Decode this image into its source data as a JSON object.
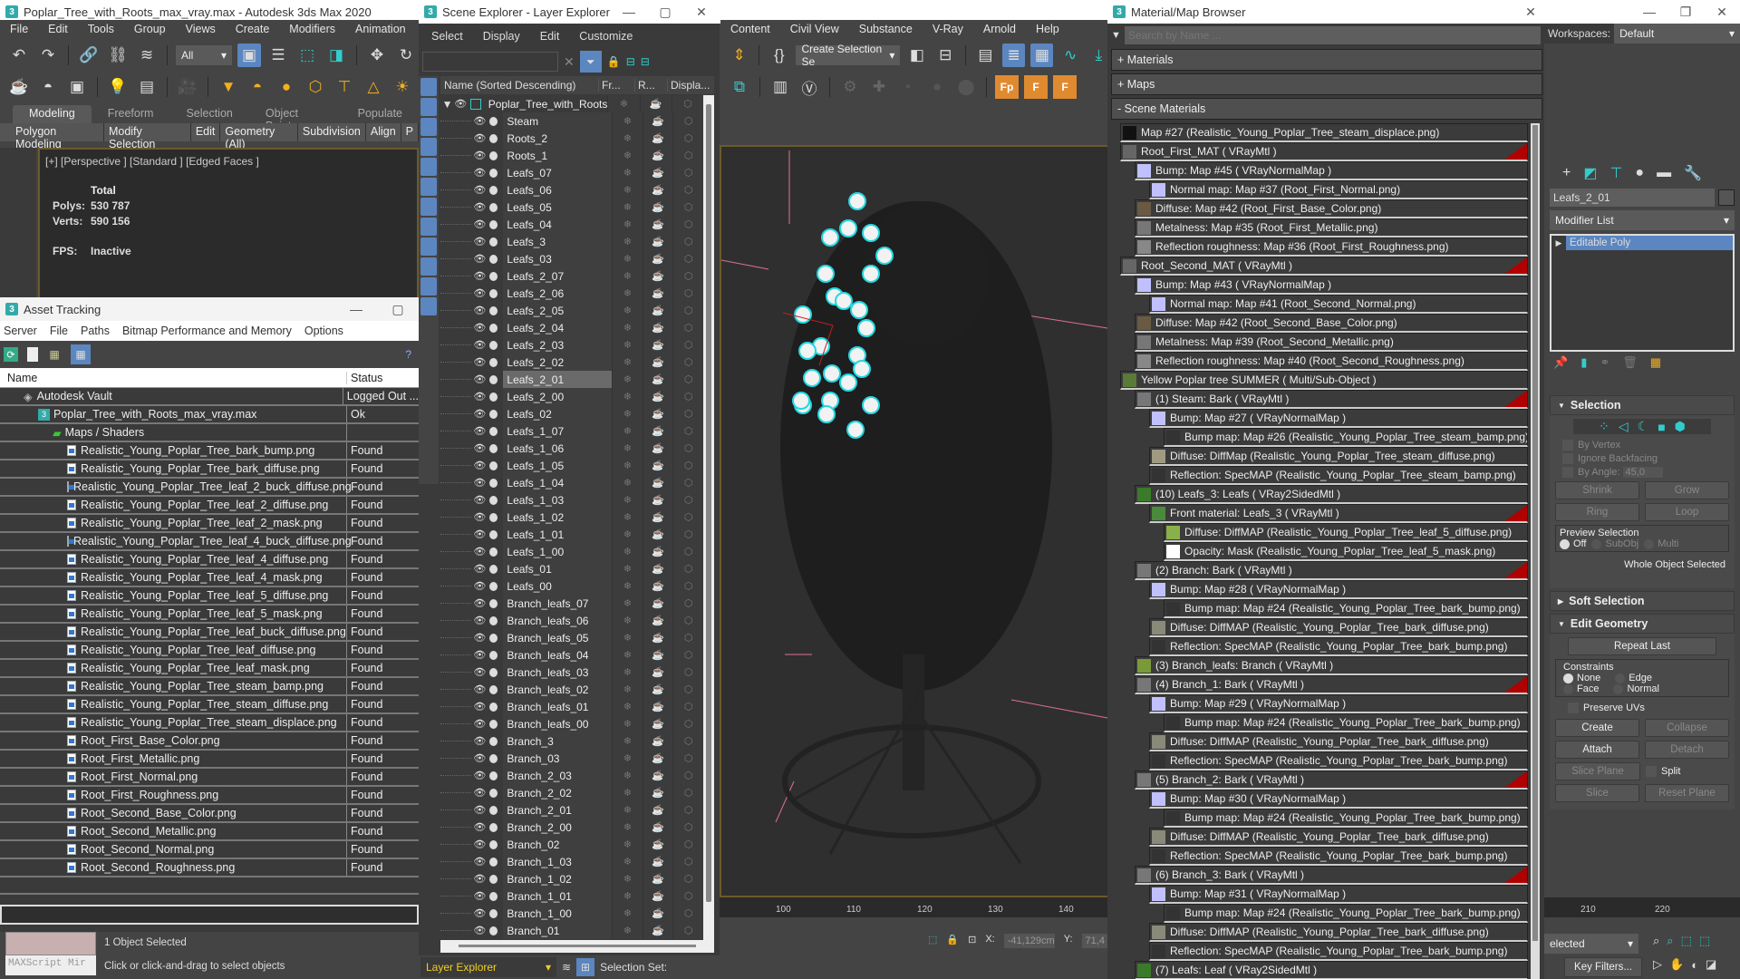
{
  "app": {
    "title": "Poplar_Tree_with_Roots_max_vray.max - Autodesk 3ds Max 2020",
    "logo": "3",
    "menu": [
      "File",
      "Edit",
      "Tools",
      "Group",
      "Views",
      "Create",
      "Modifiers",
      "Animation"
    ],
    "menu_right": [
      "Content",
      "Civil View",
      "Substance",
      "V-Ray",
      "Arnold",
      "Help"
    ],
    "selection_filter": "All",
    "create_selection_set": "Create Selection Se",
    "workspaces_label": "Workspaces:",
    "workspaces_value": "Default",
    "ribbon_tabs": [
      "Modeling",
      "Freeform",
      "Selection",
      "Object Paint",
      "Populate"
    ],
    "ribbon_items": [
      "Polygon Modeling",
      "Modify Selection",
      "Edit",
      "Geometry (All)",
      "Subdivision",
      "Align",
      "P"
    ]
  },
  "viewport": {
    "label": "[+] [Perspective ] [Standard ] [Edged Faces ]",
    "stats_header": "Total",
    "polys_label": "Polys:",
    "polys_value": "530 787",
    "verts_label": "Verts:",
    "verts_value": "590 156",
    "fps_label": "FPS:",
    "fps_value": "Inactive",
    "ruler_ticks": [
      "100",
      "110",
      "120",
      "130",
      "140"
    ],
    "ruler_ticks_right": [
      "210",
      "220"
    ],
    "x_label": "X:",
    "x_value": "-41,129cm",
    "y_label": "Y:",
    "y_value": "71,4"
  },
  "asset_tracking": {
    "title": "Asset Tracking",
    "menu": [
      "Server",
      "File",
      "Paths",
      "Bitmap Performance and Memory",
      "Options"
    ],
    "col_name": "Name",
    "col_status": "Status",
    "vault": {
      "name": "Autodesk Vault",
      "status": "Logged Out ..."
    },
    "file": {
      "name": "Poplar_Tree_with_Roots_max_vray.max",
      "status": "Ok"
    },
    "group": "Maps / Shaders",
    "items": [
      {
        "name": "Realistic_Young_Poplar_Tree_bark_bump.png",
        "status": "Found"
      },
      {
        "name": "Realistic_Young_Poplar_Tree_bark_diffuse.png",
        "status": "Found"
      },
      {
        "name": "Realistic_Young_Poplar_Tree_leaf_2_buck_diffuse.png",
        "status": "Found"
      },
      {
        "name": "Realistic_Young_Poplar_Tree_leaf_2_diffuse.png",
        "status": "Found"
      },
      {
        "name": "Realistic_Young_Poplar_Tree_leaf_2_mask.png",
        "status": "Found"
      },
      {
        "name": "Realistic_Young_Poplar_Tree_leaf_4_buck_diffuse.png",
        "status": "Found"
      },
      {
        "name": "Realistic_Young_Poplar_Tree_leaf_4_diffuse.png",
        "status": "Found"
      },
      {
        "name": "Realistic_Young_Poplar_Tree_leaf_4_mask.png",
        "status": "Found"
      },
      {
        "name": "Realistic_Young_Poplar_Tree_leaf_5_diffuse.png",
        "status": "Found"
      },
      {
        "name": "Realistic_Young_Poplar_Tree_leaf_5_mask.png",
        "status": "Found"
      },
      {
        "name": "Realistic_Young_Poplar_Tree_leaf_buck_diffuse.png",
        "status": "Found"
      },
      {
        "name": "Realistic_Young_Poplar_Tree_leaf_diffuse.png",
        "status": "Found"
      },
      {
        "name": "Realistic_Young_Poplar_Tree_leaf_mask.png",
        "status": "Found"
      },
      {
        "name": "Realistic_Young_Poplar_Tree_steam_bamp.png",
        "status": "Found"
      },
      {
        "name": "Realistic_Young_Poplar_Tree_steam_diffuse.png",
        "status": "Found"
      },
      {
        "name": "Realistic_Young_Poplar_Tree_steam_displace.png",
        "status": "Found"
      },
      {
        "name": "Root_First_Base_Color.png",
        "status": "Found"
      },
      {
        "name": "Root_First_Metallic.png",
        "status": "Found"
      },
      {
        "name": "Root_First_Normal.png",
        "status": "Found"
      },
      {
        "name": "Root_First_Roughness.png",
        "status": "Found"
      },
      {
        "name": "Root_Second_Base_Color.png",
        "status": "Found"
      },
      {
        "name": "Root_Second_Metallic.png",
        "status": "Found"
      },
      {
        "name": "Root_Second_Normal.png",
        "status": "Found"
      },
      {
        "name": "Root_Second_Roughness.png",
        "status": "Found"
      }
    ]
  },
  "scene_explorer": {
    "title": "Scene Explorer - Layer Explorer",
    "menu": [
      "Select",
      "Display",
      "Edit",
      "Customize"
    ],
    "col_name": "Name (Sorted Descending)",
    "col_freeze": "Fr...",
    "col_render": "R...",
    "col_display": "Displa...",
    "root": "Poplar_Tree_with_Roots",
    "selected": "Leafs_2_01",
    "items": [
      "Steam",
      "Roots_2",
      "Roots_1",
      "Leafs_07",
      "Leafs_06",
      "Leafs_05",
      "Leafs_04",
      "Leafs_3",
      "Leafs_03",
      "Leafs_2_07",
      "Leafs_2_06",
      "Leafs_2_05",
      "Leafs_2_04",
      "Leafs_2_03",
      "Leafs_2_02",
      "Leafs_2_01",
      "Leafs_2_00",
      "Leafs_02",
      "Leafs_1_07",
      "Leafs_1_06",
      "Leafs_1_05",
      "Leafs_1_04",
      "Leafs_1_03",
      "Leafs_1_02",
      "Leafs_1_01",
      "Leafs_1_00",
      "Leafs_01",
      "Leafs_00",
      "Branch_leafs_07",
      "Branch_leafs_06",
      "Branch_leafs_05",
      "Branch_leafs_04",
      "Branch_leafs_03",
      "Branch_leafs_02",
      "Branch_leafs_01",
      "Branch_leafs_00",
      "Branch_3",
      "Branch_03",
      "Branch_2_03",
      "Branch_2_02",
      "Branch_2_01",
      "Branch_2_00",
      "Branch_02",
      "Branch_1_03",
      "Branch_1_02",
      "Branch_1_01",
      "Branch_1_00",
      "Branch_01"
    ],
    "footer_mode": "Layer Explorer",
    "selection_set_label": "Selection Set:"
  },
  "material_browser": {
    "title": "Material/Map Browser",
    "search_placeholder": "Search by Name ...",
    "sections": [
      "+ Materials",
      "+ Maps",
      "- Scene Materials"
    ],
    "rows": [
      {
        "text": "Map #27 (Realistic_Young_Poplar_Tree_steam_displace.png)",
        "indent": 0,
        "swatch": "#111111",
        "red": false
      },
      {
        "text": "Root_First_MAT  ( VRayMtl )",
        "indent": 0,
        "swatch": "#666666",
        "red": true
      },
      {
        "text": "Bump: Map #45  ( VRayNormalMap )",
        "indent": 1,
        "swatch": "#c0c0ff",
        "red": false
      },
      {
        "text": "Normal map: Map #37 (Root_First_Normal.png)",
        "indent": 2,
        "swatch": "#c0c0ff",
        "red": false
      },
      {
        "text": "Diffuse: Map #42 (Root_First_Base_Color.png)",
        "indent": 1,
        "swatch": "#6a5a44",
        "red": false
      },
      {
        "text": "Metalness: Map #35 (Root_First_Metallic.png)",
        "indent": 1,
        "swatch": "#777777",
        "red": false
      },
      {
        "text": "Reflection roughness: Map #36 (Root_First_Roughness.png)",
        "indent": 1,
        "swatch": "#888888",
        "red": false
      },
      {
        "text": "Root_Second_MAT  ( VRayMtl )",
        "indent": 0,
        "swatch": "#666666",
        "red": true
      },
      {
        "text": "Bump: Map #43  ( VRayNormalMap )",
        "indent": 1,
        "swatch": "#c0c0ff",
        "red": false
      },
      {
        "text": "Normal map: Map #41 (Root_Second_Normal.png)",
        "indent": 2,
        "swatch": "#c0c0ff",
        "red": false
      },
      {
        "text": "Diffuse: Map #42 (Root_Second_Base_Color.png)",
        "indent": 1,
        "swatch": "#6a5a44",
        "red": false
      },
      {
        "text": "Metalness: Map #39 (Root_Second_Metallic.png)",
        "indent": 1,
        "swatch": "#777777",
        "red": false
      },
      {
        "text": "Reflection roughness: Map #40 (Root_Second_Roughness.png)",
        "indent": 1,
        "swatch": "#888888",
        "red": false
      },
      {
        "text": "Yellow Poplar tree SUMMER  ( Multi/Sub-Object )",
        "indent": 0,
        "swatch": "#5a7a3a",
        "red": false
      },
      {
        "text": "(1) Steam: Bark  ( VRayMtl )",
        "indent": 1,
        "swatch": "#777777",
        "red": true
      },
      {
        "text": "Bump: Map #27  ( VRayNormalMap )",
        "indent": 2,
        "swatch": "#c0c0ff",
        "red": false
      },
      {
        "text": "Bump map: Map #26 (Realistic_Young_Poplar_Tree_steam_bamp.png)",
        "indent": 3,
        "swatch": "#333333",
        "red": false
      },
      {
        "text": "Diffuse: DiffMap (Realistic_Young_Poplar_Tree_steam_diffuse.png)",
        "indent": 2,
        "swatch": "#a09a80",
        "red": false
      },
      {
        "text": "Reflection: SpecMAP (Realistic_Young_Poplar_Tree_steam_bamp.png)",
        "indent": 2,
        "swatch": "#333333",
        "red": false
      },
      {
        "text": "(10) Leafs_3: Leafs  ( VRay2SidedMtl )",
        "indent": 1,
        "swatch": "#3a7a2a",
        "red": false
      },
      {
        "text": "Front material: Leafs_3  ( VRayMtl )",
        "indent": 2,
        "swatch": "#4a8a3a",
        "red": true
      },
      {
        "text": "Diffuse: DiffMAP (Realistic_Young_Poplar_Tree_leaf_5_diffuse.png)",
        "indent": 3,
        "swatch": "#8ab04a",
        "red": false
      },
      {
        "text": "Opacity: Mask (Realistic_Young_Poplar_Tree_leaf_5_mask.png)",
        "indent": 3,
        "swatch": "#ffffff",
        "red": false
      },
      {
        "text": "(2) Branch: Bark  ( VRayMtl )",
        "indent": 1,
        "swatch": "#777777",
        "red": true
      },
      {
        "text": "Bump: Map #28  ( VRayNormalMap )",
        "indent": 2,
        "swatch": "#c0c0ff",
        "red": false
      },
      {
        "text": "Bump map: Map #24 (Realistic_Young_Poplar_Tree_bark_bump.png)",
        "indent": 3,
        "swatch": "#333333",
        "red": false
      },
      {
        "text": "Diffuse: DiffMAP (Realistic_Young_Poplar_Tree_bark_diffuse.png)",
        "indent": 2,
        "swatch": "#8a8a7a",
        "red": false
      },
      {
        "text": "Reflection: SpecMAP (Realistic_Young_Poplar_Tree_bark_bump.png)",
        "indent": 2,
        "swatch": "#333333",
        "red": false
      },
      {
        "text": "(3) Branch_leafs: Branch  ( VRayMtl )",
        "indent": 1,
        "swatch": "#7a9a3a",
        "red": false
      },
      {
        "text": "(4) Branch_1: Bark  ( VRayMtl )",
        "indent": 1,
        "swatch": "#777777",
        "red": true
      },
      {
        "text": "Bump: Map #29  ( VRayNormalMap )",
        "indent": 2,
        "swatch": "#c0c0ff",
        "red": false
      },
      {
        "text": "Bump map: Map #24 (Realistic_Young_Poplar_Tree_bark_bump.png)",
        "indent": 3,
        "swatch": "#333333",
        "red": false
      },
      {
        "text": "Diffuse: DiffMAP (Realistic_Young_Poplar_Tree_bark_diffuse.png)",
        "indent": 2,
        "swatch": "#8a8a7a",
        "red": false
      },
      {
        "text": "Reflection: SpecMAP (Realistic_Young_Poplar_Tree_bark_bump.png)",
        "indent": 2,
        "swatch": "#333333",
        "red": false
      },
      {
        "text": "(5) Branch_2: Bark  ( VRayMtl )",
        "indent": 1,
        "swatch": "#777777",
        "red": true
      },
      {
        "text": "Bump: Map #30  ( VRayNormalMap )",
        "indent": 2,
        "swatch": "#c0c0ff",
        "red": false
      },
      {
        "text": "Bump map: Map #24 (Realistic_Young_Poplar_Tree_bark_bump.png)",
        "indent": 3,
        "swatch": "#333333",
        "red": false
      },
      {
        "text": "Diffuse: DiffMAP (Realistic_Young_Poplar_Tree_bark_diffuse.png)",
        "indent": 2,
        "swatch": "#8a8a7a",
        "red": false
      },
      {
        "text": "Reflection: SpecMAP (Realistic_Young_Poplar_Tree_bark_bump.png)",
        "indent": 2,
        "swatch": "#333333",
        "red": false
      },
      {
        "text": "(6) Branch_3: Bark  ( VRayMtl )",
        "indent": 1,
        "swatch": "#777777",
        "red": true
      },
      {
        "text": "Bump: Map #31  ( VRayNormalMap )",
        "indent": 2,
        "swatch": "#c0c0ff",
        "red": false
      },
      {
        "text": "Bump map: Map #24 (Realistic_Young_Poplar_Tree_bark_bump.png)",
        "indent": 3,
        "swatch": "#333333",
        "red": false
      },
      {
        "text": "Diffuse: DiffMAP (Realistic_Young_Poplar_Tree_bark_diffuse.png)",
        "indent": 2,
        "swatch": "#8a8a7a",
        "red": false
      },
      {
        "text": "Reflection: SpecMAP (Realistic_Young_Poplar_Tree_bark_bump.png)",
        "indent": 2,
        "swatch": "#333333",
        "red": false
      },
      {
        "text": "(7) Leafs: Leaf  ( VRay2SidedMtl )",
        "indent": 1,
        "swatch": "#3a7a2a",
        "red": false
      }
    ]
  },
  "command_panel": {
    "object_name": "Leafs_2_01",
    "modifier_list": "Modifier List",
    "stack_item": "Editable Poly",
    "selection_title": "Selection",
    "by_vertex": "By Vertex",
    "ignore_backfacing": "Ignore Backfacing",
    "by_angle": "By Angle:",
    "by_angle_value": "45,0",
    "shrink": "Shrink",
    "grow": "Grow",
    "ring": "Ring",
    "loop": "Loop",
    "preview_selection": "Preview Selection",
    "preview_off": "Off",
    "preview_subobj": "SubObj",
    "preview_multi": "Multi",
    "whole_object": "Whole Object Selected",
    "soft_selection": "Soft Selection",
    "edit_geometry": "Edit Geometry",
    "repeat_last": "Repeat Last",
    "constraints": "Constraints",
    "c_none": "None",
    "c_edge": "Edge",
    "c_face": "Face",
    "c_normal": "Normal",
    "preserve_uvs": "Preserve UVs",
    "create": "Create",
    "collapse": "Collapse",
    "attach": "Attach",
    "detach": "Detach",
    "slice_plane": "Slice Plane",
    "split": "Split",
    "slice": "Slice",
    "reset_plane": "Reset Plane"
  },
  "status": {
    "maxscript": "MAXScript Mir",
    "objects_selected": "1 Object Selected",
    "prompt": "Click or click-and-drag to select objects",
    "selected_dropdown": "elected",
    "key_filters": "Key Filters..."
  },
  "colors": {
    "accent_blue": "#5b86c0",
    "selection_cyan": "#22d8e0",
    "warning_red": "#b00000",
    "gizmo_pink": "#e07090"
  }
}
